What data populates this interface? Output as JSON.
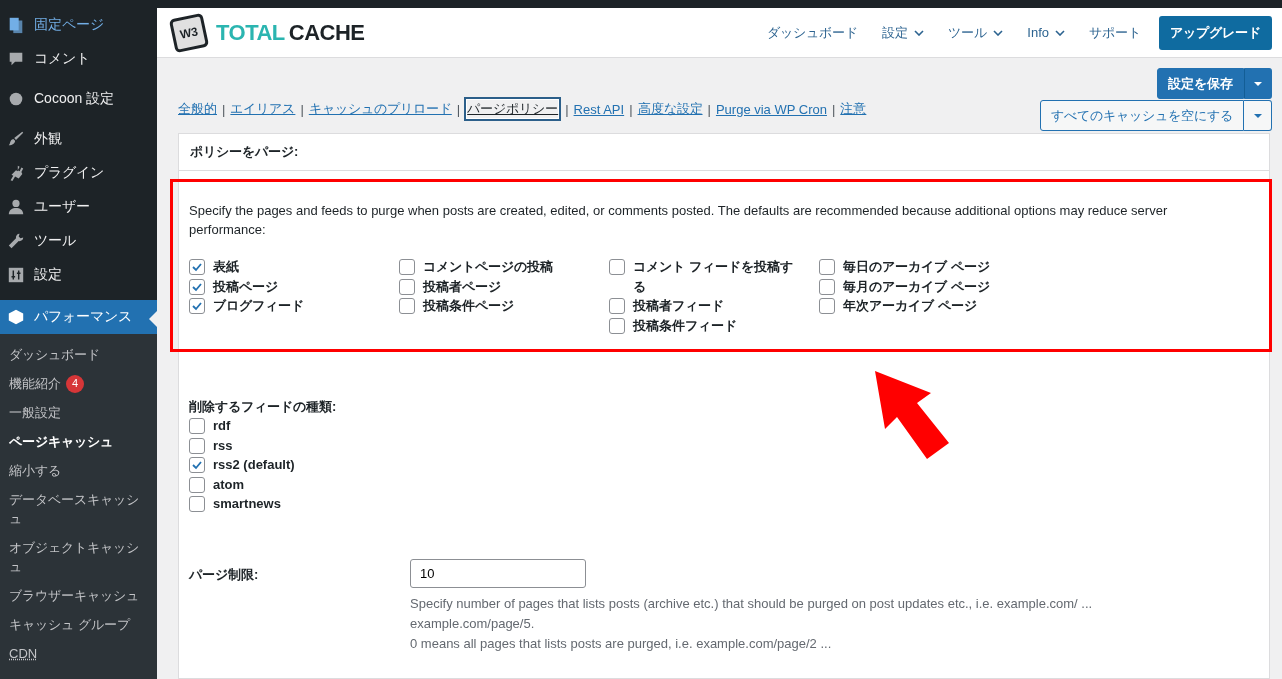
{
  "sidebar": {
    "items": [
      {
        "label": "固定ページ",
        "selected": false,
        "current": true
      },
      {
        "label": "コメント",
        "selected": false,
        "current": false
      },
      {
        "label": "Cocoon 設定",
        "selected": false,
        "current": false
      },
      {
        "label": "外観",
        "selected": false,
        "current": false
      },
      {
        "label": "プラグイン",
        "selected": false,
        "current": false
      },
      {
        "label": "ユーザー",
        "selected": false,
        "current": false
      },
      {
        "label": "ツール",
        "selected": false,
        "current": false
      },
      {
        "label": "設定",
        "selected": false,
        "current": false
      },
      {
        "label": "パフォーマンス",
        "selected": true,
        "current": false
      }
    ],
    "submenu": [
      {
        "label": "ダッシュボード",
        "selected": false
      },
      {
        "label": "機能紹介",
        "selected": false,
        "badge": "4"
      },
      {
        "label": "一般設定",
        "selected": false
      },
      {
        "label": "ページキャッシュ",
        "selected": true
      },
      {
        "label": "縮小する",
        "selected": false
      },
      {
        "label": "データベースキャッシュ",
        "selected": false
      },
      {
        "label": "オブジェクトキャッシュ",
        "selected": false
      },
      {
        "label": "ブラウザーキャッシュ",
        "selected": false
      },
      {
        "label": "キャッシュ グループ",
        "selected": false
      },
      {
        "label": "CDN",
        "selected": false
      }
    ]
  },
  "header": {
    "logo": {
      "mark": "W3",
      "word_1": "TOTAL",
      "word_2": "CACHE"
    },
    "nav": [
      {
        "label": "ダッシュボード",
        "dropdown": false
      },
      {
        "label": "設定",
        "dropdown": true
      },
      {
        "label": "ツール",
        "dropdown": true
      },
      {
        "label": "Info",
        "dropdown": true
      },
      {
        "label": "サポート",
        "dropdown": false
      }
    ],
    "upgrade": "アップグレード"
  },
  "tabs": [
    {
      "label": "全般的",
      "selected": false
    },
    {
      "label": "エイリアス",
      "selected": false
    },
    {
      "label": "キャッシュのプリロード",
      "selected": false
    },
    {
      "label": "パージポリシー",
      "selected": true
    },
    {
      "label": "Rest API",
      "selected": false
    },
    {
      "label": "高度な設定",
      "selected": false
    },
    {
      "label": "Purge via WP Cron",
      "selected": false
    },
    {
      "label": "注意",
      "selected": false
    }
  ],
  "tab_separator": "|",
  "actions": {
    "save": "設定を保存",
    "empty_cache": "すべてのキャッシュを空にする"
  },
  "panel": {
    "title": "ポリシーをパージ:",
    "description": "Specify the pages and feeds to purge when posts are created, edited, or comments posted. The defaults are recommended because additional options may reduce server performance:",
    "page_columns": [
      [
        {
          "label": "表紙",
          "checked": true
        },
        {
          "label": "投稿ページ",
          "checked": true
        },
        {
          "label": "ブログフィード",
          "checked": true
        }
      ],
      [
        {
          "label": "コメントページの投稿",
          "checked": false
        },
        {
          "label": "投稿者ページ",
          "checked": false
        },
        {
          "label": "投稿条件ページ",
          "checked": false
        }
      ],
      [
        {
          "label": "コメント フィードを投稿する",
          "checked": false
        },
        {
          "label": "投稿者フィード",
          "checked": false
        },
        {
          "label": "投稿条件フィード",
          "checked": false
        }
      ],
      [
        {
          "label": "毎日のアーカイブ ページ",
          "checked": false
        },
        {
          "label": "毎月のアーカイブ ページ",
          "checked": false
        },
        {
          "label": "年次アーカイブ ページ",
          "checked": false
        }
      ]
    ],
    "feeds_label": "削除するフィードの種類:",
    "feeds": [
      {
        "label": "rdf",
        "checked": false
      },
      {
        "label": "rss",
        "checked": false
      },
      {
        "label": "rss2 (default)",
        "checked": true
      },
      {
        "label": "atom",
        "checked": false
      },
      {
        "label": "smartnews",
        "checked": false
      }
    ],
    "page_limit": {
      "label": "パージ制限:",
      "value": "10",
      "help": [
        "Specify number of pages that lists posts (archive etc.) that should be purged on post updates etc., i.e. example.com/ ...",
        "example.com/page/5.",
        "0 means all pages that lists posts are purged, i.e. example.com/page/2 ..."
      ]
    }
  }
}
